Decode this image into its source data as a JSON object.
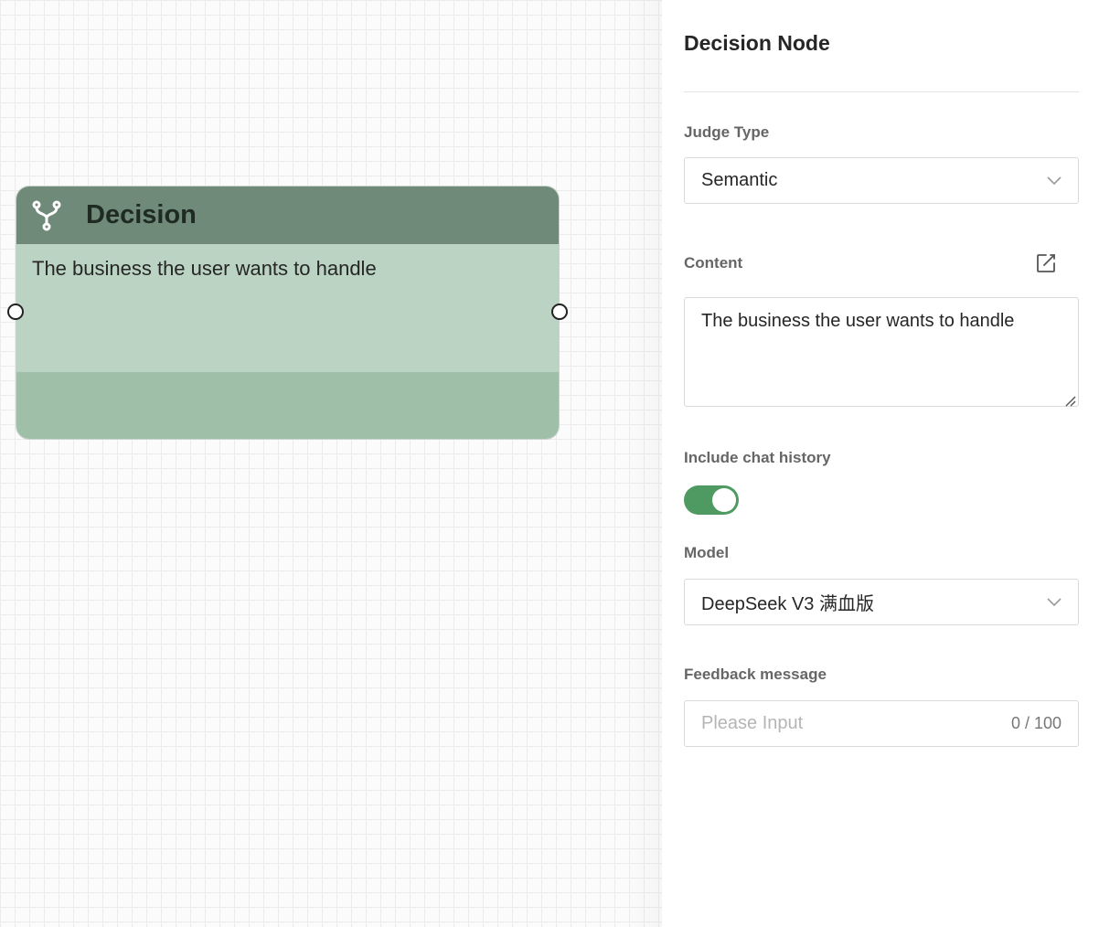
{
  "canvas": {
    "node": {
      "title": "Decision",
      "icon": "fork-icon",
      "content": "The business the user wants to handle",
      "colors": {
        "header": "#6f8a78",
        "body": "#bbd3c3",
        "footer": "#9fbfa9"
      }
    }
  },
  "panel": {
    "title": "Decision Node",
    "judge_type": {
      "label": "Judge Type",
      "value": "Semantic"
    },
    "content": {
      "label": "Content",
      "value": "The business the user wants to handle"
    },
    "chat_history": {
      "label": "Include chat history",
      "enabled": true
    },
    "model": {
      "label": "Model",
      "value": "DeepSeek V3 满血版"
    },
    "feedback": {
      "label": "Feedback message",
      "value": "",
      "placeholder": "Please Input",
      "counter": "0 / 100"
    },
    "accent_color": "#4f9a62"
  }
}
